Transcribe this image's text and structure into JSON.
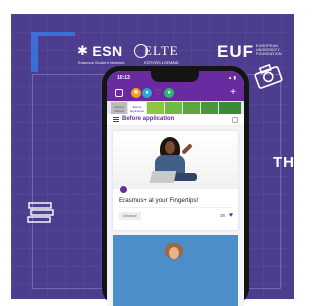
{
  "promo": {
    "logos": {
      "esn_name": "ESN",
      "esn_sub": "Erasmus Student Network",
      "elte_name": "ELTE",
      "elte_sub": "EÖTVÖS LORÁND",
      "elte_sub2": "UNIVERSITY",
      "euf_name": "EUF",
      "euf_sub": "EUROPEAN\nUNIVERSITY\nFOUNDATION"
    },
    "side_text": "TH",
    "colors": {
      "background": "#4d3d8f",
      "accent": "#3a6ed8",
      "app_purple": "#6a2aa0"
    }
  },
  "phone": {
    "status": {
      "time": "10:13",
      "right": "▲ ▮"
    },
    "header": {
      "esn_icon": "esn-icon",
      "plus": "+"
    },
    "tabs": [
      {
        "label": "Getting started"
      },
      {
        "label": "Before application"
      },
      {
        "label": ""
      },
      {
        "label": ""
      },
      {
        "label": ""
      },
      {
        "label": ""
      },
      {
        "label": ""
      }
    ],
    "section_title": "Before application",
    "card": {
      "title": "Erasmus+ at your Fingertips!",
      "tag": "General",
      "likes": "39"
    }
  }
}
